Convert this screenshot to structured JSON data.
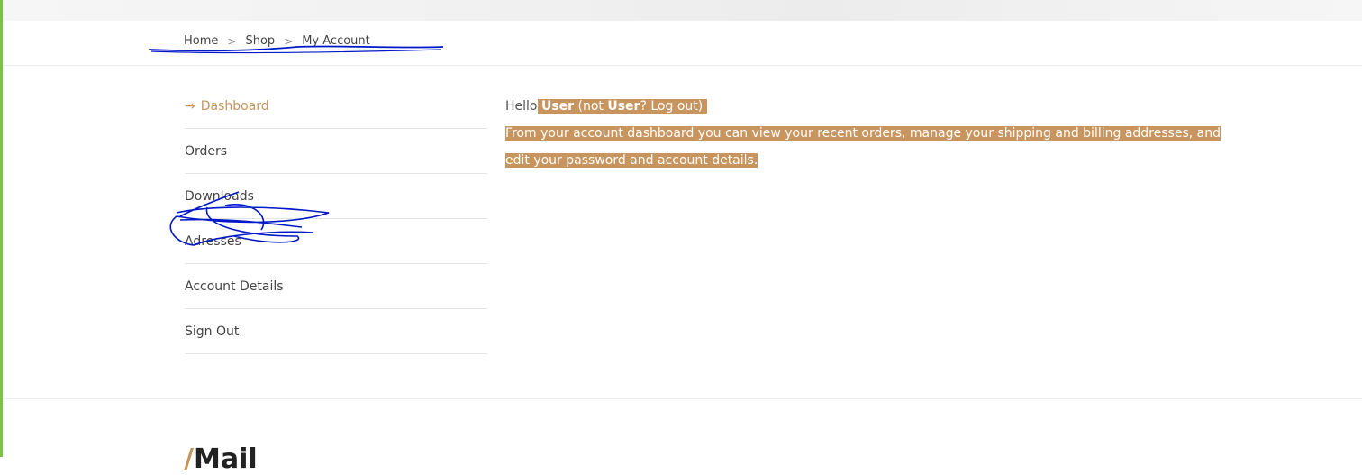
{
  "breadcrumb": {
    "home": "Home",
    "shop": "Shop",
    "current": "My Account",
    "separator": ">"
  },
  "account_nav": {
    "items": [
      {
        "label": "Dashboard",
        "active": true,
        "arrow": "→"
      },
      {
        "label": "Orders"
      },
      {
        "label": "Downloads"
      },
      {
        "label": "Adresses"
      },
      {
        "label": "Account Details"
      },
      {
        "label": "Sign Out"
      }
    ]
  },
  "dashboard": {
    "hello": "Hello",
    "user_name": "User",
    "not_text": "(not",
    "question": "?",
    "logout": "Log out",
    "close_paren": ")",
    "body_text": "From your account dashboard you can view your recent orders, manage your shipping and billing addresses, and edit your password and account details."
  },
  "bottom_section": {
    "heading_prefix": "/",
    "heading_partial": "Mail"
  },
  "colors": {
    "accent": "#c4955d",
    "highlight": "#c9955f",
    "scribble": "#0018c8",
    "left_edge": "#7cc242"
  }
}
